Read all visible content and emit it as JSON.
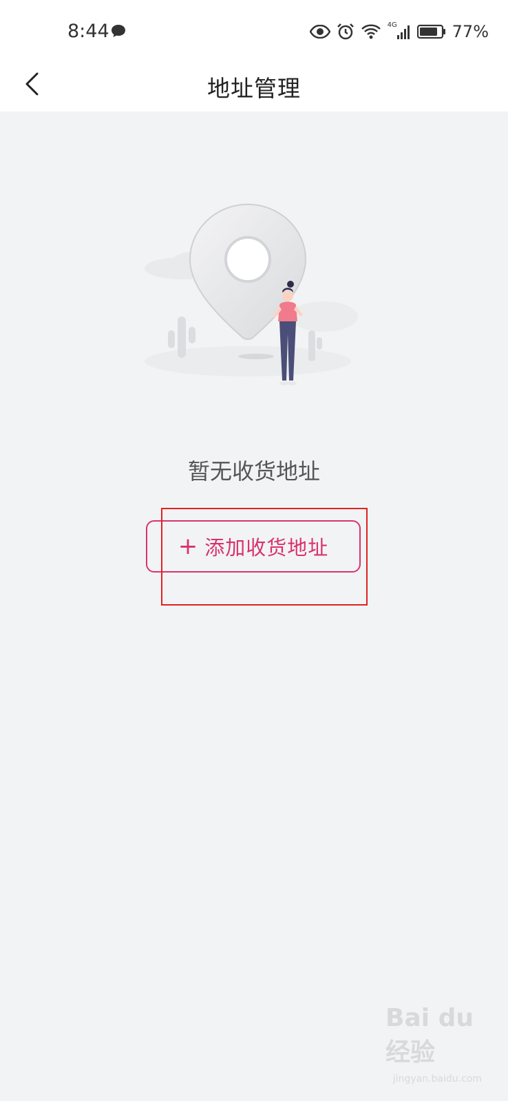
{
  "status_bar": {
    "time": "8:44",
    "battery_percent": "77%",
    "network_type": "4G",
    "icons": [
      "chat-icon",
      "eye-icon",
      "alarm-icon",
      "wifi-icon",
      "signal-icon",
      "battery-icon"
    ]
  },
  "navbar": {
    "title": "地址管理",
    "back_icon": "chevron-left-icon"
  },
  "empty_state": {
    "illustration": "location-pin-illustration",
    "message": "暂无收货地址"
  },
  "add_button": {
    "icon": "+",
    "label": "添加收货地址"
  },
  "watermark": {
    "text": "Bai du 经验",
    "sub": "jingyan.baidu.com"
  },
  "colors": {
    "accent": "#d8326d",
    "background": "#f2f3f5",
    "highlight": "#e02020"
  }
}
